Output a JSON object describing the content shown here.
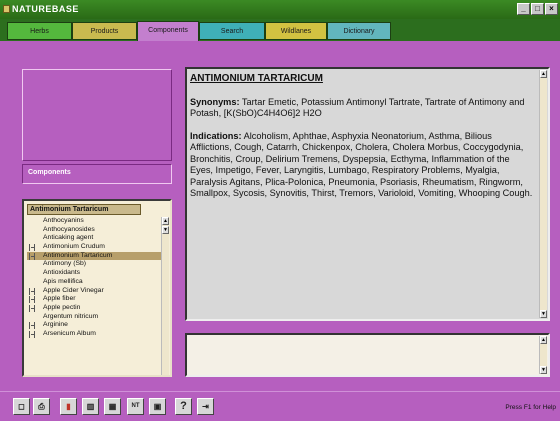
{
  "window": {
    "title": "NATUREBASE",
    "controls": [
      "_",
      "□",
      "×"
    ]
  },
  "tabs": [
    {
      "label": "Herbs",
      "color": "#54b83d"
    },
    {
      "label": "Products",
      "color": "#c9ba4f"
    },
    {
      "label": "Components",
      "color": "#c37fce",
      "active": true
    },
    {
      "label": "Search",
      "color": "#3fb0b8"
    },
    {
      "label": "Wildlanes",
      "color": "#d2c241"
    },
    {
      "label": "Dictionary",
      "color": "#62b6bd"
    }
  ],
  "sidebar": {
    "components_label": "Components",
    "search_value": "Antimonium Tartaricum",
    "items": [
      {
        "label": "Anthocyanins",
        "marked": false,
        "selected": false
      },
      {
        "label": "Anthocyanosides",
        "marked": false,
        "selected": false
      },
      {
        "label": "Anticaking agent",
        "marked": false,
        "selected": false
      },
      {
        "label": "Antimonium Crudum",
        "marked": true,
        "selected": false
      },
      {
        "label": "Antimonium Tartaricum",
        "marked": true,
        "selected": true
      },
      {
        "label": "Antimony (Sb)",
        "marked": false,
        "selected": false
      },
      {
        "label": "Antioxidants",
        "marked": false,
        "selected": false
      },
      {
        "label": "Apis mellifica",
        "marked": false,
        "selected": false
      },
      {
        "label": "Apple Cider Vinegar",
        "marked": true,
        "selected": false
      },
      {
        "label": "Apple fiber",
        "marked": true,
        "selected": false
      },
      {
        "label": "Apple pectin",
        "marked": true,
        "selected": false
      },
      {
        "label": "Argentum nitricum",
        "marked": false,
        "selected": false
      },
      {
        "label": "Arginine",
        "marked": true,
        "selected": false
      },
      {
        "label": "Arsenicum Album",
        "marked": true,
        "selected": false
      }
    ]
  },
  "main": {
    "heading": "ANTIMONIUM TARTARICUM",
    "synonyms_label": "Synonyms:",
    "synonyms_text": " Tartar Emetic, Potassium Antimonyl Tartrate, Tartrate of Antimony and Potash, [K(SbO)C4H4O6]2 H2O",
    "indications_label": "Indications:",
    "indications_text": " Alcoholism, Aphthae, Asphyxia Neonatorium, Asthma, Bilious Afflictions, Cough, Catarrh, Chickenpox, Cholera, Cholera Morbus, Coccygodynia, Bronchitis, Croup, Delirium Tremens, Dyspepsia, Ecthyma, Inflammation of the Eyes, Impetigo, Fever, Laryngitis, Lumbago, Respiratory Problems, Myalgia, Paralysis Agitans, Plica-Polonica, Pneumonia, Psoriasis, Rheumatism, Ringworm, Smallpox, Sycosis, Synovitis, Thirst, Tremors, Varioloid, Vomiting, Whooping Cough."
  },
  "toolbar": {
    "buttons": [
      {
        "name": "new-icon",
        "glyph": "◻"
      },
      {
        "name": "print-icon",
        "glyph": "⎙"
      },
      {
        "name": "bookmark-icon",
        "glyph": "▮"
      },
      {
        "name": "columns-icon",
        "glyph": "▥"
      },
      {
        "name": "grid-icon",
        "glyph": "▦"
      },
      {
        "name": "numbers-icon",
        "glyph": "NT"
      },
      {
        "name": "image-icon",
        "glyph": "▣"
      },
      {
        "name": "help-icon",
        "glyph": "?"
      },
      {
        "name": "exit-icon",
        "glyph": "⇥"
      }
    ],
    "status": "Press F1 for Help"
  }
}
